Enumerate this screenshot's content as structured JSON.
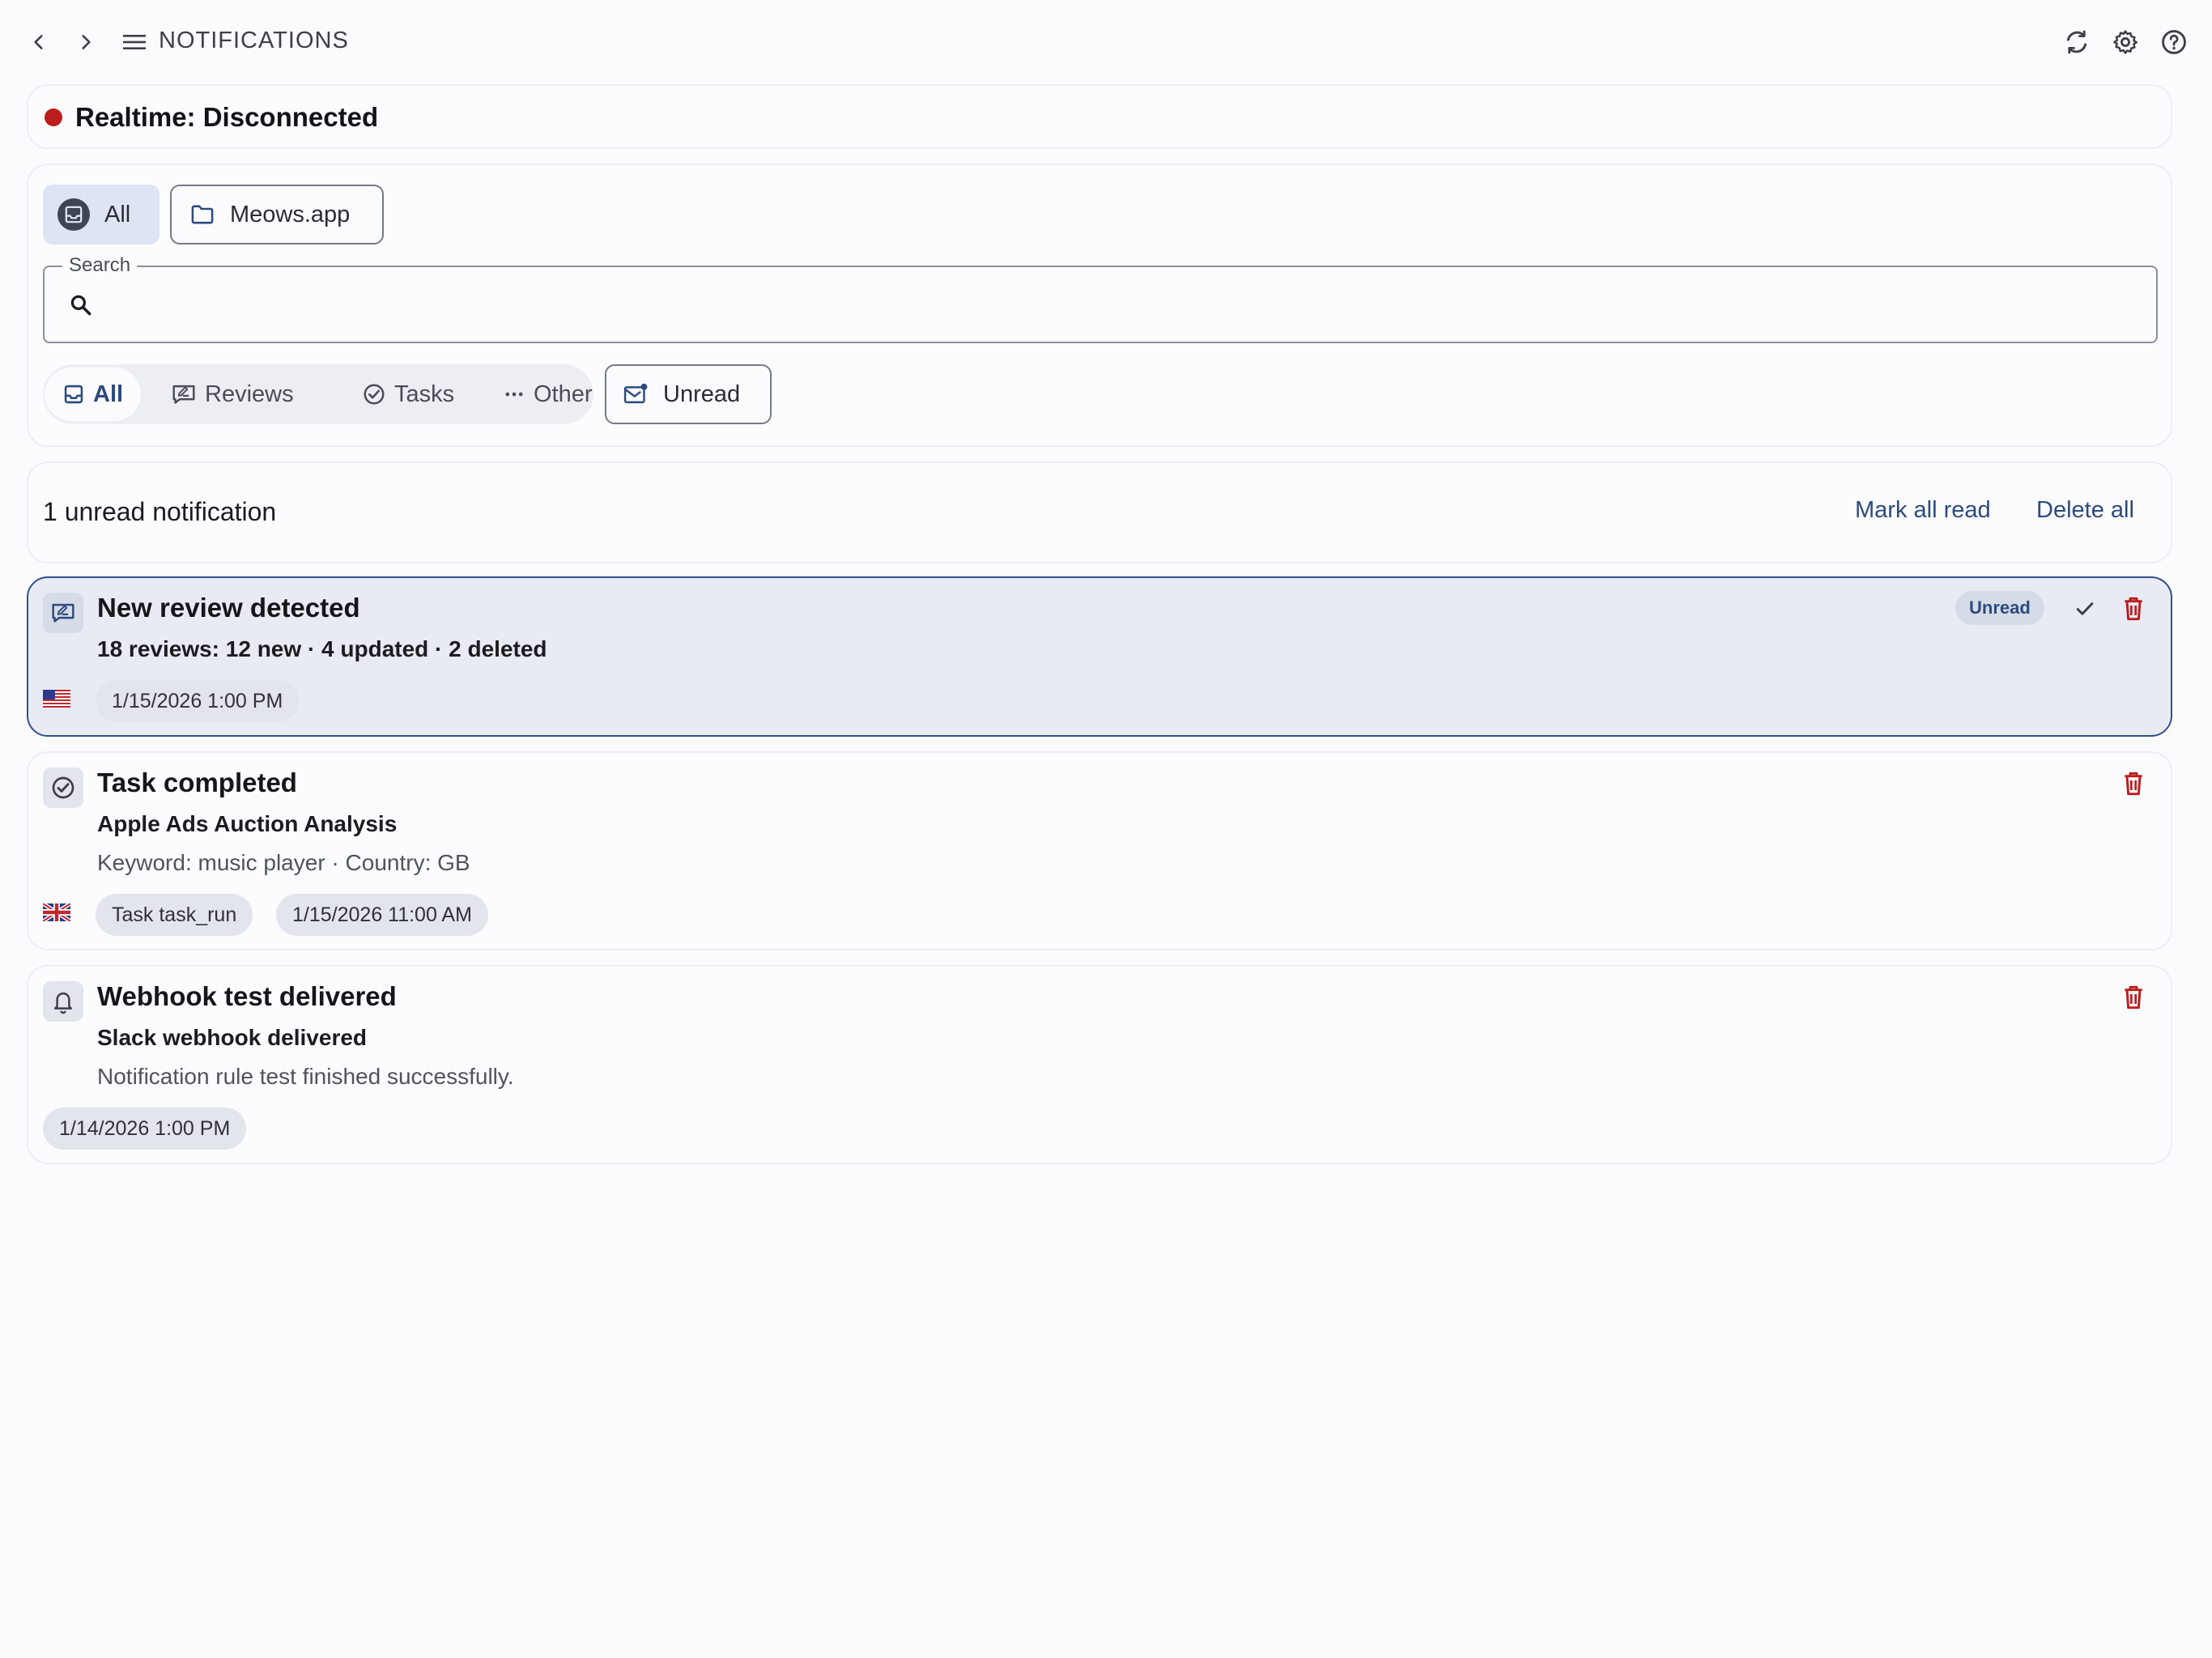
{
  "header": {
    "title": "NOTIFICATIONS",
    "icons": [
      "chevron-left-icon",
      "chevron-right-icon",
      "menu-icon",
      "refresh-icon",
      "gear-icon",
      "help-icon"
    ]
  },
  "realtime": {
    "status": "Realtime: Disconnected",
    "dot_color": "#bd1c1c"
  },
  "workspaces": [
    {
      "label": "All",
      "selected": true
    },
    {
      "label": "Meows.app",
      "selected": false
    }
  ],
  "search": {
    "label": "Search",
    "value": "",
    "placeholder": ""
  },
  "filters": {
    "categories": [
      {
        "label": "All",
        "active": true
      },
      {
        "label": "Reviews",
        "active": false
      },
      {
        "label": "Tasks",
        "active": false
      },
      {
        "label": "Other",
        "active": false
      }
    ],
    "unread_label": "Unread"
  },
  "summary": {
    "count_text": "1 unread notification",
    "mark_all_read": "Mark all read",
    "delete_all": "Delete all"
  },
  "notifications": [
    {
      "title": "New review detected",
      "subtitle": "18 reviews: 12 new · 4 updated · 2 deleted",
      "country_flag": "US",
      "tags": [
        "1/15/2026 1:00 PM"
      ],
      "unread_badge": "Unread",
      "icon": "review-icon",
      "unread": true
    },
    {
      "title": "Task completed",
      "subtitle": "Apple Ads Auction Analysis",
      "description": "Keyword: music player · Country: GB",
      "country_flag": "GB",
      "tags": [
        "Task task_run",
        "1/15/2026 11:00 AM"
      ],
      "icon": "check-circle-icon",
      "unread": false
    },
    {
      "title": "Webhook test delivered",
      "subtitle": "Slack webhook delivered",
      "description": "Notification rule test finished successfully.",
      "tags": [
        "1/14/2026 1:00 PM"
      ],
      "icon": "bell-icon",
      "unread": false
    }
  ],
  "colors": {
    "accent": "#2d4a7c",
    "danger": "#bd1c1c",
    "background": "#fbfbfe"
  }
}
